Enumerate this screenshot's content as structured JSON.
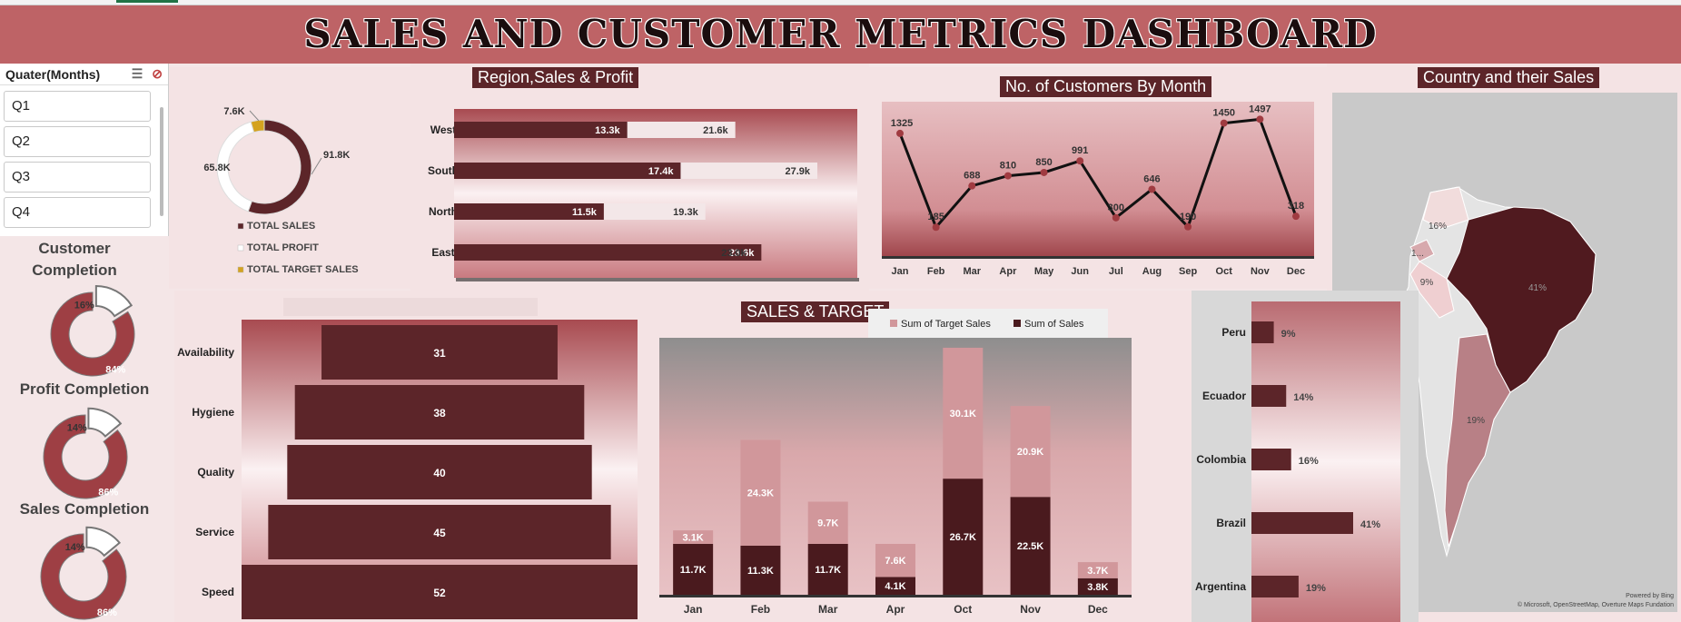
{
  "title": "SALES AND CUSTOMER METRICS DASHBOARD",
  "slicer": {
    "header": "Quater(Months)",
    "items": [
      {
        "label": "Q1",
        "selected": true
      },
      {
        "label": "Q2",
        "selected": false
      },
      {
        "label": "Q3",
        "selected": false
      },
      {
        "label": "Q4",
        "selected": true
      }
    ]
  },
  "completion": {
    "customer": {
      "title": "Customer Completion",
      "done_label": "84%",
      "remaining_label": "16%",
      "done_pct": 84
    },
    "profit": {
      "title": "Profit Completion",
      "done_label": "86%",
      "remaining_label": "14%",
      "done_pct": 86
    },
    "sales": {
      "title": "Sales Completion",
      "done_label": "86%",
      "remaining_label": "14%",
      "done_pct": 86
    }
  },
  "donut": {
    "labels": {
      "sales": "91.8K",
      "profit": "65.8K",
      "target": "7.6K"
    },
    "legend": [
      "TOTAL SALES",
      "TOTAL PROFIT",
      "TOTAL TARGET SALES"
    ],
    "colors": {
      "sales": "#5c2529",
      "profit": "#ffffff",
      "target": "#d4a21f"
    }
  },
  "region_chart": {
    "title": "Region,Sales & Profit",
    "rows": [
      {
        "region": "West",
        "profit": 13.3,
        "sales": 21.6,
        "profit_label": "13.3k",
        "sales_label": "21.6k"
      },
      {
        "region": "South",
        "profit": 17.4,
        "sales": 27.9,
        "profit_label": "17.4k",
        "sales_label": "27.9k"
      },
      {
        "region": "North",
        "profit": 11.5,
        "sales": 19.3,
        "profit_label": "11.5k",
        "sales_label": "19.3k"
      },
      {
        "region": "East",
        "profit": 23.6,
        "sales": 23.0,
        "profit_label": "23.6k",
        "sales_label": "23.0k"
      }
    ]
  },
  "customers_chart": {
    "title": "No. of Customers By Month",
    "months": [
      "Jan",
      "Feb",
      "Mar",
      "Apr",
      "May",
      "Jun",
      "Jul",
      "Aug",
      "Sep",
      "Oct",
      "Nov",
      "Dec"
    ],
    "values": [
      1325,
      185,
      688,
      810,
      850,
      991,
      300,
      646,
      190,
      1450,
      1497,
      318
    ]
  },
  "map_panel": {
    "title": "Country and their Sales",
    "labels": [
      "16%",
      "1...",
      "9%",
      "41%",
      "19%"
    ],
    "credit1": "Powered by Bing",
    "credit2": "© Microsoft, OpenStreetMap, Overture Maps Fundation"
  },
  "satisfaction_chart": {
    "rows": [
      {
        "label": "Availability",
        "value": 31
      },
      {
        "label": "Hygiene",
        "value": 38
      },
      {
        "label": "Quality",
        "value": 40
      },
      {
        "label": "Service",
        "value": 45
      },
      {
        "label": "Speed",
        "value": 52
      }
    ]
  },
  "chart_data": [
    {
      "type": "bar",
      "title": "SALES & TARGET",
      "categories": [
        "Jan",
        "Feb",
        "Mar",
        "Apr",
        "Oct",
        "Nov",
        "Dec"
      ],
      "series": [
        {
          "name": "Sum of Sales",
          "values": [
            11.7,
            11.3,
            11.7,
            4.1,
            26.7,
            22.5,
            3.8
          ],
          "labels": [
            "11.7K",
            "11.3K",
            "11.7K",
            "4.1K",
            "26.7K",
            "22.5K",
            "3.8K"
          ],
          "color": "#4a1a1e"
        },
        {
          "name": "Sum of Target Sales",
          "values": [
            3.1,
            24.3,
            9.7,
            7.6,
            30.1,
            20.9,
            3.7
          ],
          "labels": [
            "3.1K",
            "24.3K",
            "9.7K",
            "7.6K",
            "30.1K",
            "20.9K",
            "3.7K"
          ],
          "color": "#d1979b"
        }
      ],
      "stacked": true
    },
    {
      "type": "bar",
      "orientation": "horizontal",
      "categories": [
        "Peru",
        "Ecuador",
        "Colombia",
        "Brazil",
        "Argentina"
      ],
      "values": [
        9,
        14,
        16,
        41,
        19
      ],
      "labels": [
        "9%",
        "14%",
        "16%",
        "41%",
        "19%"
      ]
    }
  ]
}
